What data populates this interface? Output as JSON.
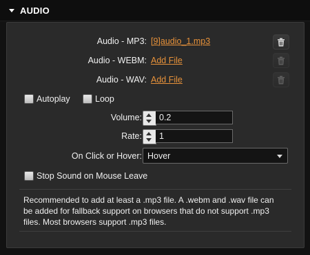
{
  "section": {
    "title": "AUDIO"
  },
  "files": [
    {
      "label": "Audio - MP3:",
      "link": "[9]audio_1.mp3",
      "delete_enabled": true
    },
    {
      "label": "Audio - WEBM:",
      "link": "Add File",
      "delete_enabled": false
    },
    {
      "label": "Audio - WAV:",
      "link": "Add File",
      "delete_enabled": false
    }
  ],
  "options": {
    "autoplay_label": "Autoplay",
    "autoplay_checked": false,
    "loop_label": "Loop",
    "loop_checked": false
  },
  "volume": {
    "label": "Volume:",
    "value": "0.2"
  },
  "rate": {
    "label": "Rate:",
    "value": "1"
  },
  "trigger": {
    "label": "On Click or Hover:",
    "value": "Hover"
  },
  "stop_on_leave": {
    "label": "Stop Sound on Mouse Leave",
    "checked": false
  },
  "note": "Recommended to add at least a .mp3 file. A .webm and .wav file can be added for fallback support on browsers that do not support .mp3 files. Most browsers support .mp3 files.",
  "icons": {
    "collapse": "triangle-down-icon",
    "delete": "trash-icon",
    "dropdown": "chevron-down-icon",
    "stepper": "up-down-arrows-icon"
  },
  "colors": {
    "link": "#e8923a",
    "panel_bg": "#2a2a2a",
    "page_bg": "#121212"
  }
}
